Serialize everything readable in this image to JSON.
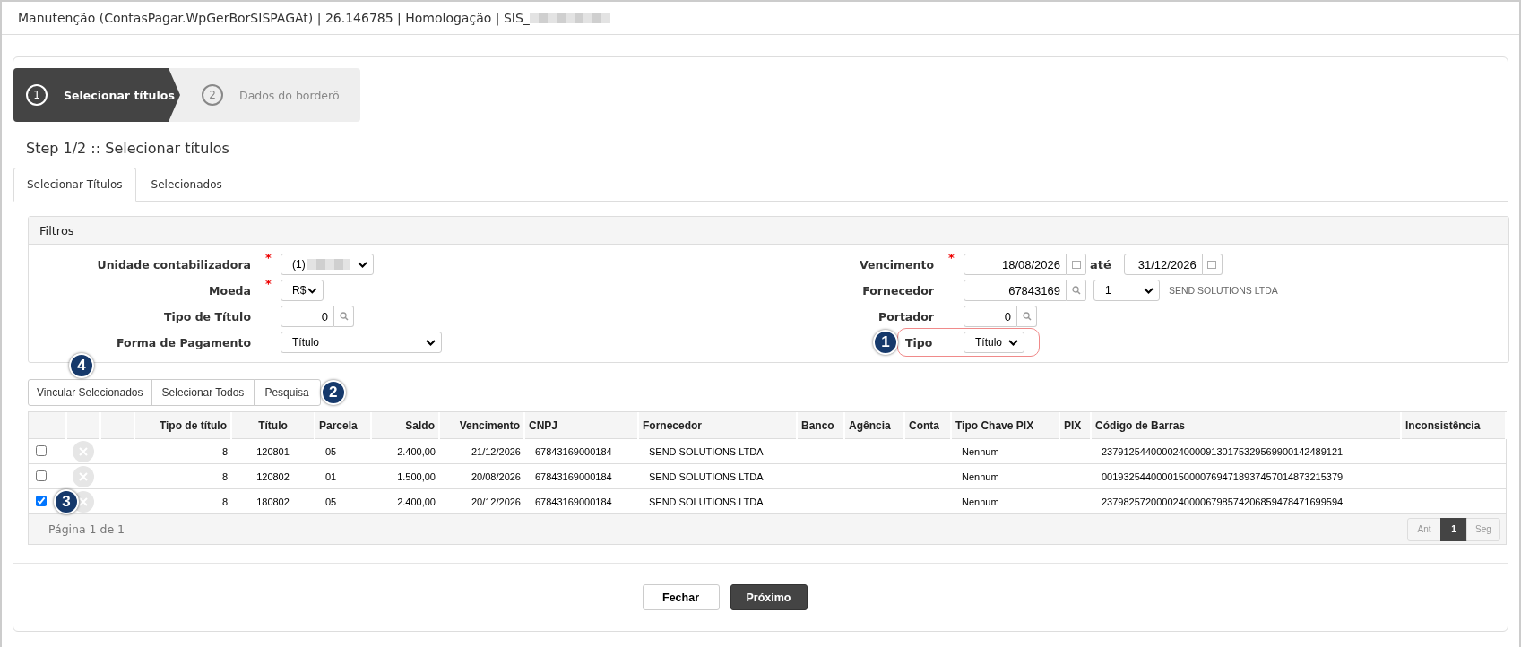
{
  "window": {
    "title": "Manutenção (ContasPagar.WpGerBorSISPAGAt) | 26.146785 | Homologação | SIS_",
    "title_redacted": true
  },
  "wizard": [
    {
      "number": "1",
      "label": "Selecionar títulos",
      "selected": true
    },
    {
      "number": "2",
      "label": "Dados do borderô",
      "selected": false
    }
  ],
  "step_title": "Step 1/2 :: Selecionar títulos",
  "tabs": [
    {
      "label": "Selecionar Títulos",
      "selected": true
    },
    {
      "label": "Selecionados",
      "selected": false
    }
  ],
  "filters": {
    "title": "Filtros",
    "left": [
      {
        "label": "Unidade contabilizadora",
        "required_mark": "*",
        "kind": "select",
        "value": "(1)",
        "redacted": true
      },
      {
        "label": "Moeda",
        "required_mark": "*",
        "kind": "select",
        "value": "R$"
      },
      {
        "label": "Tipo de Título",
        "kind": "lookup",
        "value": "0"
      },
      {
        "label": "Forma de Pagamento",
        "kind": "select",
        "value": "Título"
      }
    ],
    "right": [
      {
        "label": "Vencimento",
        "required_mark": "*",
        "kind": "daterange",
        "value": "18/08/2026",
        "separator": "até",
        "value_to": "31/12/2026"
      },
      {
        "label": "Fornecedor",
        "kind": "lookup",
        "value": "67843169",
        "option": "1",
        "description": "SEND SOLUTIONS LTDA"
      },
      {
        "label": "Portador",
        "kind": "lookup",
        "value": "0"
      },
      {
        "label": "Tipo",
        "kind": "select",
        "value": "Título",
        "highlighted": true,
        "annotation": "1"
      }
    ]
  },
  "toolbar": [
    {
      "label": "Vincular Selecionados",
      "annotation": "4"
    },
    {
      "label": "Selecionar Todos"
    },
    {
      "label": "Pesquisa",
      "annotation": "2"
    }
  ],
  "table": {
    "columns": [
      "Tipo de título",
      "Título",
      "Parcela",
      "Saldo",
      "Vencimento",
      "CNPJ",
      "Fornecedor",
      "Banco",
      "Agência",
      "Conta",
      "Tipo Chave PIX",
      "PIX",
      "Código de Barras",
      "Inconsistência"
    ],
    "rows": [
      {
        "checked": false,
        "cells": [
          "8",
          "120801",
          "05",
          "2.400,00",
          "21/12/2026",
          "67843169000184",
          "SEND SOLUTIONS LTDA",
          "",
          "",
          "",
          "Nenhum",
          "",
          "23791254400002400009130175329569900142489121",
          ""
        ]
      },
      {
        "checked": false,
        "cells": [
          "8",
          "120802",
          "01",
          "1.500,00",
          "20/08/2026",
          "67843169000184",
          "SEND SOLUTIONS LTDA",
          "",
          "",
          "",
          "Nenhum",
          "",
          "00193254400001500007694718937457014873215379",
          ""
        ]
      },
      {
        "checked": true,
        "annotation": "3",
        "cells": [
          "8",
          "180802",
          "05",
          "2.400,00",
          "20/12/2026",
          "67843169000184",
          "SEND SOLUTIONS LTDA",
          "",
          "",
          "",
          "Nenhum",
          "",
          "23798257200002400006798574206859478471699594",
          ""
        ]
      }
    ]
  },
  "pagination": {
    "info": "Página 1 de 1",
    "prev": "Ant",
    "pages": [
      {
        "label": "1",
        "selected": true
      }
    ],
    "next": "Seg"
  },
  "buttons": [
    {
      "label": "Fechar",
      "kind": "secondary"
    },
    {
      "label": "Próximo",
      "kind": "primary"
    }
  ]
}
